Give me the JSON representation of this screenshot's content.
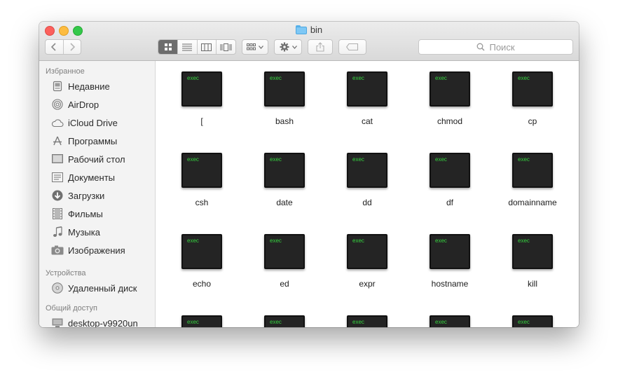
{
  "window": {
    "title": "bin"
  },
  "toolbar": {
    "back_icon": "chevron-left-icon",
    "forward_icon": "chevron-right-icon",
    "view_modes": [
      "icon-view",
      "list-view",
      "column-view",
      "cover-flow-view"
    ],
    "search_placeholder": "Поиск"
  },
  "sidebar": {
    "favorites_header": "Избранное",
    "favorites": [
      {
        "label": "Недавние",
        "icon": "recents-icon"
      },
      {
        "label": "AirDrop",
        "icon": "airdrop-icon"
      },
      {
        "label": "iCloud Drive",
        "icon": "cloud-icon"
      },
      {
        "label": "Программы",
        "icon": "applications-icon"
      },
      {
        "label": "Рабочий стол",
        "icon": "desktop-icon"
      },
      {
        "label": "Документы",
        "icon": "documents-icon"
      },
      {
        "label": "Загрузки",
        "icon": "downloads-icon"
      },
      {
        "label": "Фильмы",
        "icon": "movies-icon"
      },
      {
        "label": "Музыка",
        "icon": "music-icon"
      },
      {
        "label": "Изображения",
        "icon": "pictures-icon"
      }
    ],
    "devices_header": "Устройства",
    "devices": [
      {
        "label": "Удаленный диск",
        "icon": "disc-icon"
      }
    ],
    "shared_header": "Общий доступ",
    "shared": [
      {
        "label": "desktop-v9920un",
        "icon": "computer-icon"
      }
    ]
  },
  "files": {
    "badge": "exec",
    "items": [
      "[",
      "bash",
      "cat",
      "chmod",
      "cp",
      "csh",
      "date",
      "dd",
      "df",
      "domainname",
      "echo",
      "ed",
      "expr",
      "hostname",
      "kill",
      "",
      "",
      "",
      "",
      ""
    ]
  }
}
